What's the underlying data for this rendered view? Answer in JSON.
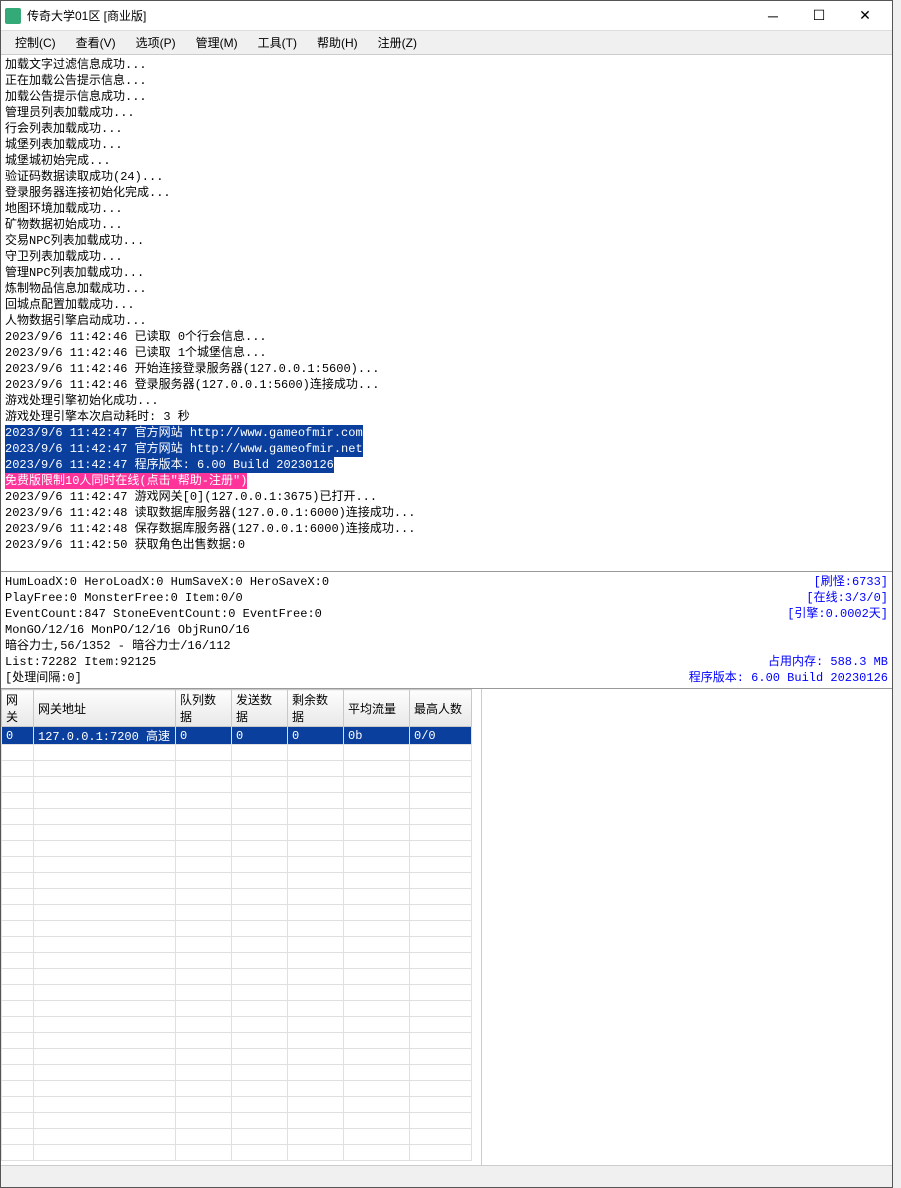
{
  "window": {
    "title": "传奇大学01区 [商业版]"
  },
  "menu": {
    "control": "控制(C)",
    "view": "查看(V)",
    "options": "选项(P)",
    "manage": "管理(M)",
    "tools": "工具(T)",
    "help": "帮助(H)",
    "register": "注册(Z)"
  },
  "log": [
    {
      "t": "加载文字过滤信息成功...",
      "c": ""
    },
    {
      "t": "正在加载公告提示信息...",
      "c": ""
    },
    {
      "t": "加载公告提示信息成功...",
      "c": ""
    },
    {
      "t": "管理员列表加载成功...",
      "c": ""
    },
    {
      "t": "行会列表加载成功...",
      "c": ""
    },
    {
      "t": "城堡列表加载成功...",
      "c": ""
    },
    {
      "t": "城堡城初始完成...",
      "c": ""
    },
    {
      "t": "验证码数据读取成功(24)...",
      "c": ""
    },
    {
      "t": "登录服务器连接初始化完成...",
      "c": ""
    },
    {
      "t": "地图环境加载成功...",
      "c": ""
    },
    {
      "t": "矿物数据初始成功...",
      "c": ""
    },
    {
      "t": "交易NPC列表加载成功...",
      "c": ""
    },
    {
      "t": "守卫列表加载成功...",
      "c": ""
    },
    {
      "t": "管理NPC列表加载成功...",
      "c": ""
    },
    {
      "t": "炼制物品信息加载成功...",
      "c": ""
    },
    {
      "t": "回城点配置加载成功...",
      "c": ""
    },
    {
      "t": "人物数据引擎启动成功...",
      "c": ""
    },
    {
      "t": "2023/9/6 11:42:46 已读取 0个行会信息...",
      "c": ""
    },
    {
      "t": "2023/9/6 11:42:46 已读取 1个城堡信息...",
      "c": ""
    },
    {
      "t": "2023/9/6 11:42:46 开始连接登录服务器(127.0.0.1:5600)...",
      "c": ""
    },
    {
      "t": "2023/9/6 11:42:46 登录服务器(127.0.0.1:5600)连接成功...",
      "c": ""
    },
    {
      "t": "游戏处理引擎初始化成功...",
      "c": ""
    },
    {
      "t": "游戏处理引擎本次启动耗时: 3 秒",
      "c": ""
    },
    {
      "t": "2023/9/6 11:42:47 官方网站 http://www.gameofmir.com",
      "c": "hl-blue"
    },
    {
      "t": "2023/9/6 11:42:47 官方网站 http://www.gameofmir.net",
      "c": "hl-blue"
    },
    {
      "t": "2023/9/6 11:42:47 程序版本: 6.00 Build 20230126",
      "c": "hl-blue"
    },
    {
      "t": "免费版限制10人同时在线(点击\"帮助-注册\")",
      "c": "hl-pink"
    },
    {
      "t": "2023/9/6 11:42:47 游戏网关[0](127.0.0.1:3675)已打开...",
      "c": ""
    },
    {
      "t": "2023/9/6 11:42:48 读取数据库服务器(127.0.0.1:6000)连接成功...",
      "c": ""
    },
    {
      "t": "2023/9/6 11:42:48 保存数据库服务器(127.0.0.1:6000)连接成功...",
      "c": ""
    },
    {
      "t": "2023/9/6 11:42:50 获取角色出售数据:0",
      "c": ""
    }
  ],
  "stats": {
    "row1": {
      "left": "HumLoadX:0 HeroLoadX:0 HumSaveX:0 HeroSaveX:0",
      "right": "[刷怪:6733]"
    },
    "row2": {
      "left": "PlayFree:0 MonsterFree:0 Item:0/0",
      "right": "[在线:3/3/0]"
    },
    "row3": {
      "left": "EventCount:847 StoneEventCount:0 EventFree:0",
      "right": "[引擎:0.0002天]"
    },
    "row4": {
      "left": "MonGO/12/16 MonPO/12/16 ObjRunO/16",
      "right": ""
    },
    "row5": {
      "left": "暗谷力士,56/1352 - 暗谷力士/16/112",
      "right": ""
    },
    "row6": {
      "left": "List:72282 Item:92125",
      "right": "占用内存: 588.3 MB"
    },
    "row7": {
      "left": "[处理间隔:0]",
      "right": "程序版本: 6.00 Build 20230126"
    }
  },
  "table": {
    "headers": {
      "gw": "网关",
      "addr": "网关地址",
      "queue": "队列数据",
      "send": "发送数据",
      "remain": "剩余数据",
      "avg": "平均流量",
      "max": "最高人数"
    },
    "rows": [
      {
        "gw": "0",
        "addr": "127.0.0.1:7200 高速",
        "queue": "0",
        "send": "0",
        "remain": "0",
        "avg": "0b",
        "max": "0/0"
      }
    ],
    "emptyRows": 26
  }
}
